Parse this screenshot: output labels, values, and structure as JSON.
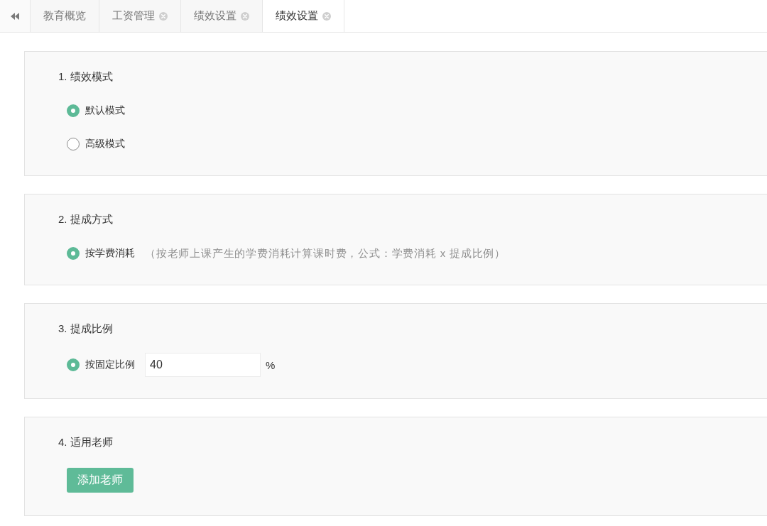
{
  "tabs": [
    {
      "label": "教育概览",
      "closable": false,
      "selected": false
    },
    {
      "label": "工资管理",
      "closable": true,
      "selected": false
    },
    {
      "label": "绩效设置",
      "closable": true,
      "selected": false
    },
    {
      "label": "绩效设置",
      "closable": true,
      "selected": true
    }
  ],
  "sections": [
    {
      "title": "1. 绩效模式",
      "kind": "options",
      "options": [
        {
          "label": "默认模式",
          "selected": true
        },
        {
          "label": "高级模式",
          "selected": false
        }
      ]
    },
    {
      "title": "2. 提成方式",
      "kind": "options",
      "options": [
        {
          "label": "按学费消耗",
          "selected": true,
          "note": "（按老师上课产生的学费消耗计算课时费，公式：学费消耗 x 提成比例）"
        }
      ]
    },
    {
      "title": "3. 提成比例",
      "kind": "options",
      "options": [
        {
          "label": "按固定比例",
          "selected": true,
          "value": "40",
          "unit": "%"
        }
      ]
    },
    {
      "title": "4. 适用老师",
      "kind": "button",
      "button": "添加老师"
    }
  ]
}
